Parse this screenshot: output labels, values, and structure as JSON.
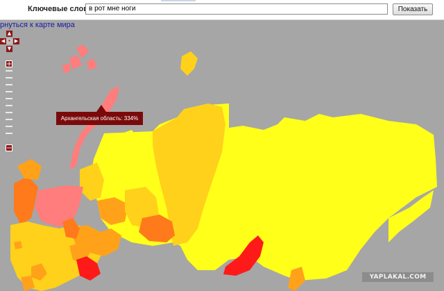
{
  "search": {
    "label": "Ключевые слова:",
    "value": "в рот мне ноги",
    "button_label": "Показать"
  },
  "map": {
    "back_link": "рнуться к карте мира",
    "tooltip": "Архангельская область: 334%",
    "colors": {
      "background": "#a6a6a6",
      "low": "#ffff1a",
      "mid": "#ffd11a",
      "midhigh": "#ffa21a",
      "high": "#ff7a1a",
      "top": "#ff1a1a",
      "highlight": "#ff7d7d"
    }
  },
  "controls": {
    "pan_up": "▲",
    "pan_left": "◀",
    "pan_center": "•",
    "pan_right": "▶",
    "pan_down": "▼",
    "zoom_in": "+",
    "zoom_out": "−"
  },
  "watermark": "YAPLAKAL.COM"
}
